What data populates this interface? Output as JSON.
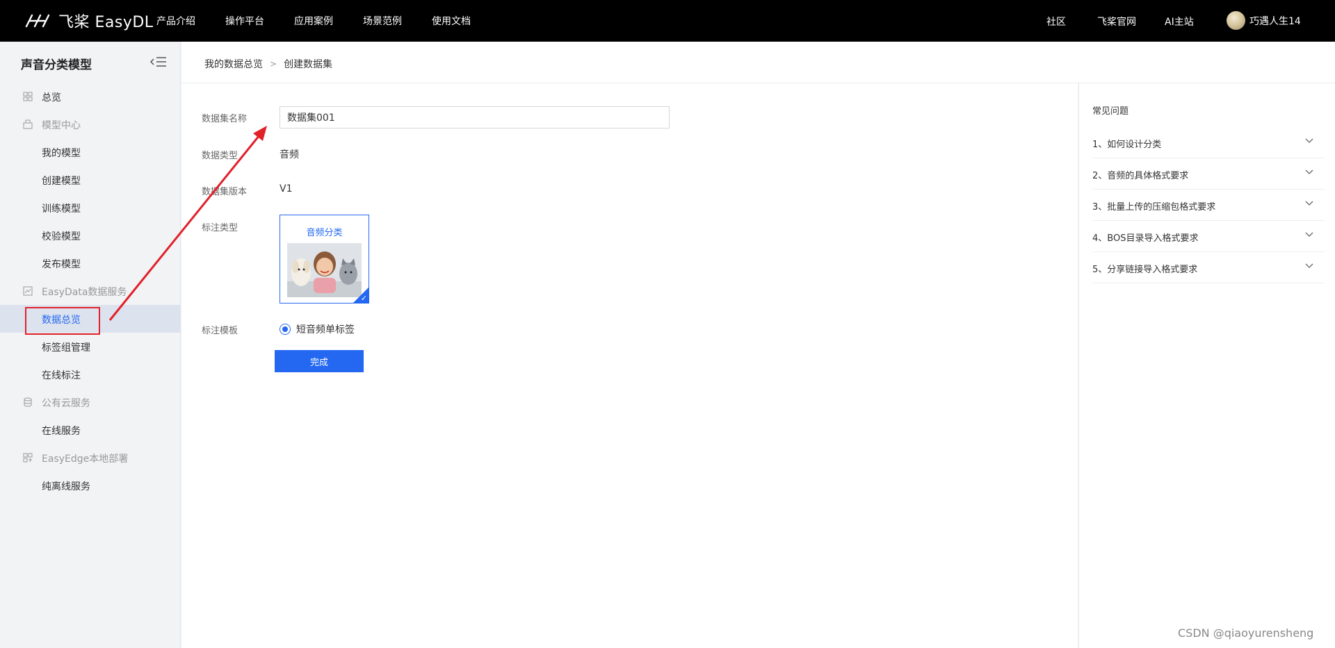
{
  "topnav": {
    "logo_text": "飞桨 EasyDL",
    "items": [
      "产品介绍",
      "操作平台",
      "应用案例",
      "场景范例",
      "使用文档"
    ],
    "right_items": [
      "社区",
      "飞桨官网",
      "AI主站"
    ],
    "user_name": "巧遇人生14"
  },
  "sidebar": {
    "title": "声音分类模型",
    "items": [
      {
        "label": "总览",
        "icon": "grid-icon"
      },
      {
        "label": "模型中心",
        "icon": "model-icon"
      },
      {
        "label": "我的模型"
      },
      {
        "label": "创建模型"
      },
      {
        "label": "训练模型"
      },
      {
        "label": "校验模型"
      },
      {
        "label": "发布模型"
      },
      {
        "label": "EasyData数据服务",
        "icon": "chart-icon"
      },
      {
        "label": "数据总览"
      },
      {
        "label": "标签组管理"
      },
      {
        "label": "在线标注"
      },
      {
        "label": "公有云服务",
        "icon": "database-icon"
      },
      {
        "label": "在线服务"
      },
      {
        "label": "EasyEdge本地部署",
        "icon": "edge-icon"
      },
      {
        "label": "纯离线服务"
      }
    ]
  },
  "breadcrumb": {
    "first": "我的数据总览",
    "separator": ">",
    "current": "创建数据集"
  },
  "form": {
    "name_label": "数据集名称",
    "name_value": "数据集001",
    "type_label": "数据类型",
    "type_value": "音频",
    "version_label": "数据集版本",
    "version_value": "V1",
    "annotation_type_label": "标注类型",
    "annotation_type_card": "音频分类",
    "template_label": "标注模板",
    "template_option": "短音频单标签",
    "submit_label": "完成"
  },
  "faq": {
    "title": "常见问题",
    "items": [
      "1、如何设计分类",
      "2、音频的具体格式要求",
      "3、批量上传的压缩包格式要求",
      "4、BOS目录导入格式要求",
      "5、分享链接导入格式要求"
    ]
  },
  "watermark": "CSDN @qiaoyurensheng",
  "colors": {
    "accent": "#2468f2",
    "annotation": "#e1202a",
    "nav_bg": "#000000"
  }
}
